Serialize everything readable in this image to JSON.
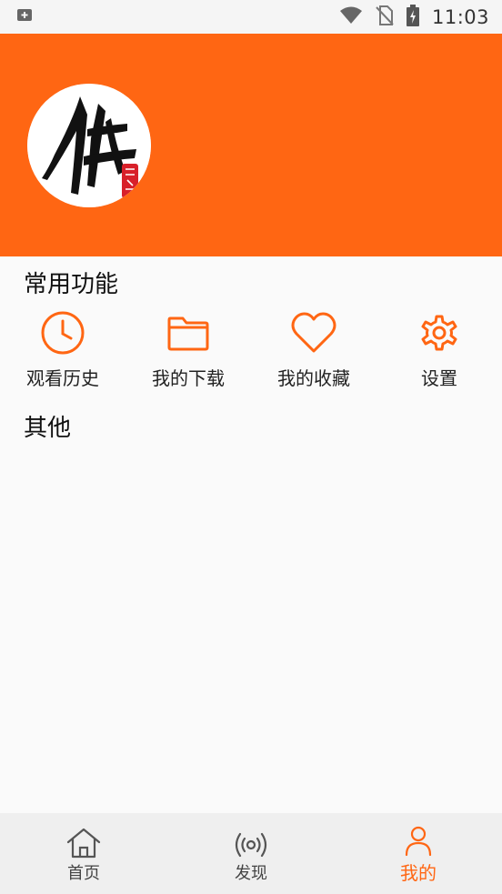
{
  "status_bar": {
    "time": "11:03",
    "icons": [
      "notification-icon",
      "wifi-icon",
      "no-sim-icon",
      "battery-charging-icon"
    ]
  },
  "header": {
    "background_color": "#ff6613",
    "avatar_icon": "calligraphy-logo"
  },
  "common_functions": {
    "title": "常用功能",
    "items": [
      {
        "label": "观看历史",
        "icon": "clock-icon"
      },
      {
        "label": "我的下载",
        "icon": "folder-icon"
      },
      {
        "label": "我的收藏",
        "icon": "heart-icon"
      },
      {
        "label": "设置",
        "icon": "gear-icon"
      }
    ]
  },
  "other": {
    "title": "其他"
  },
  "bottom_nav": {
    "items": [
      {
        "label": "首页",
        "icon": "home-icon",
        "active": false
      },
      {
        "label": "发现",
        "icon": "broadcast-icon",
        "active": false
      },
      {
        "label": "我的",
        "icon": "person-icon",
        "active": true
      }
    ]
  },
  "colors": {
    "accent": "#ff6613",
    "nav_background": "#efefef",
    "page_background": "#fafafa"
  }
}
